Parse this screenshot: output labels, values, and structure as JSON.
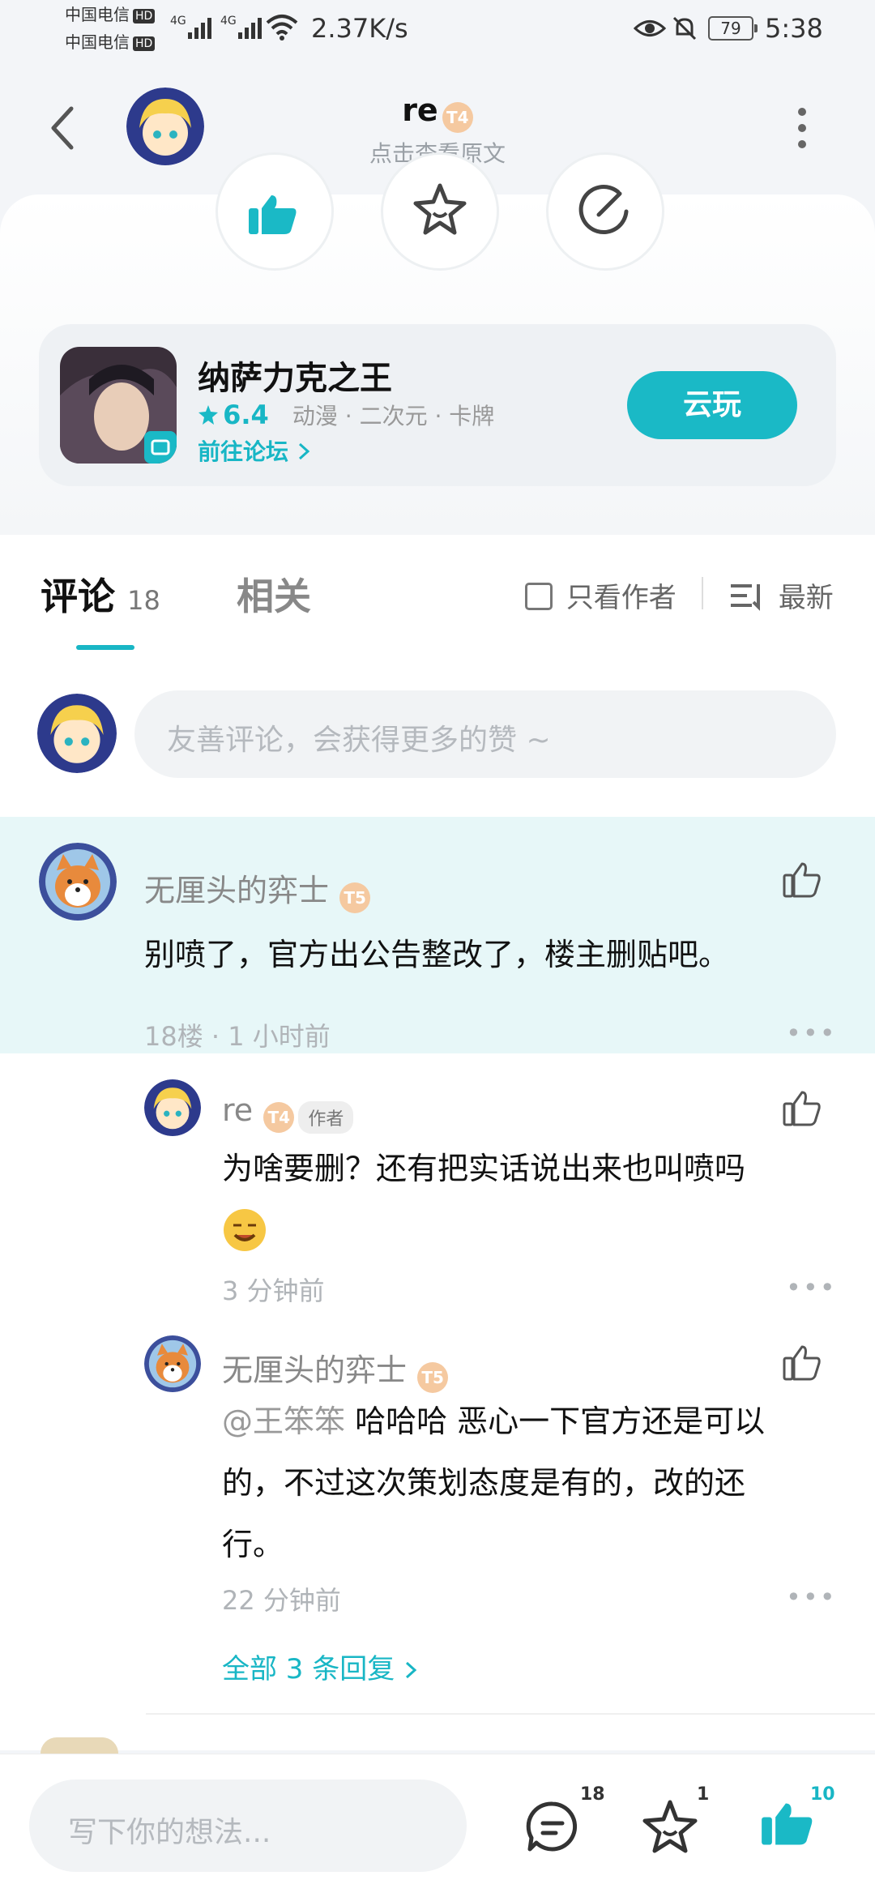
{
  "status_bar": {
    "carrier1": "中国电信",
    "carrier2": "中国电信",
    "hd": "HD",
    "net1": "4G",
    "net2": "4G",
    "speed": "2.37K/s",
    "battery": "79",
    "time": "5:38"
  },
  "header": {
    "title": "re",
    "level": "T4",
    "subtitle": "点击查看原文"
  },
  "game": {
    "name": "纳萨力克之王",
    "rating": "6.4",
    "tags": "动漫 · 二次元 · 卡牌",
    "forum_link": "前往论坛",
    "cloud_play": "云玩"
  },
  "tabs": {
    "comments_label": "评论",
    "comments_count": "18",
    "related_label": "相关",
    "author_only": "只看作者",
    "sort": "最新"
  },
  "comment_input": {
    "placeholder": "友善评论，会获得更多的赞 ~"
  },
  "comments": [
    {
      "name": "无厘头的弈士",
      "level": "T5",
      "text": "别喷了，官方出公告整改了，楼主删贴吧。",
      "meta": "18楼 · 1 小时前"
    }
  ],
  "replies": [
    {
      "name": "re",
      "level": "T4",
      "tag": "作者",
      "text": "为啥要删？还有把实话说出来也叫喷吗",
      "meta": "3 分钟前"
    },
    {
      "name": "无厘头的弈士",
      "level": "T5",
      "mention": "@王笨笨",
      "text_line1": " 哈哈哈 恶心一下官方还是可以",
      "text_line2": "的，不过这次策划态度是有的，改的还",
      "text_line3": "行。",
      "meta": "22 分钟前"
    }
  ],
  "all_replies": "全部 3 条回复",
  "bottom_bar": {
    "placeholder": "写下你的想法...",
    "comment_count": "18",
    "fav_count": "1",
    "like_count": "10"
  },
  "more_glyph": "•••",
  "colors": {
    "accent": "#1ab9c6",
    "highlight_bg": "#e7f7f8",
    "header_bg": "#f3f5f8"
  }
}
